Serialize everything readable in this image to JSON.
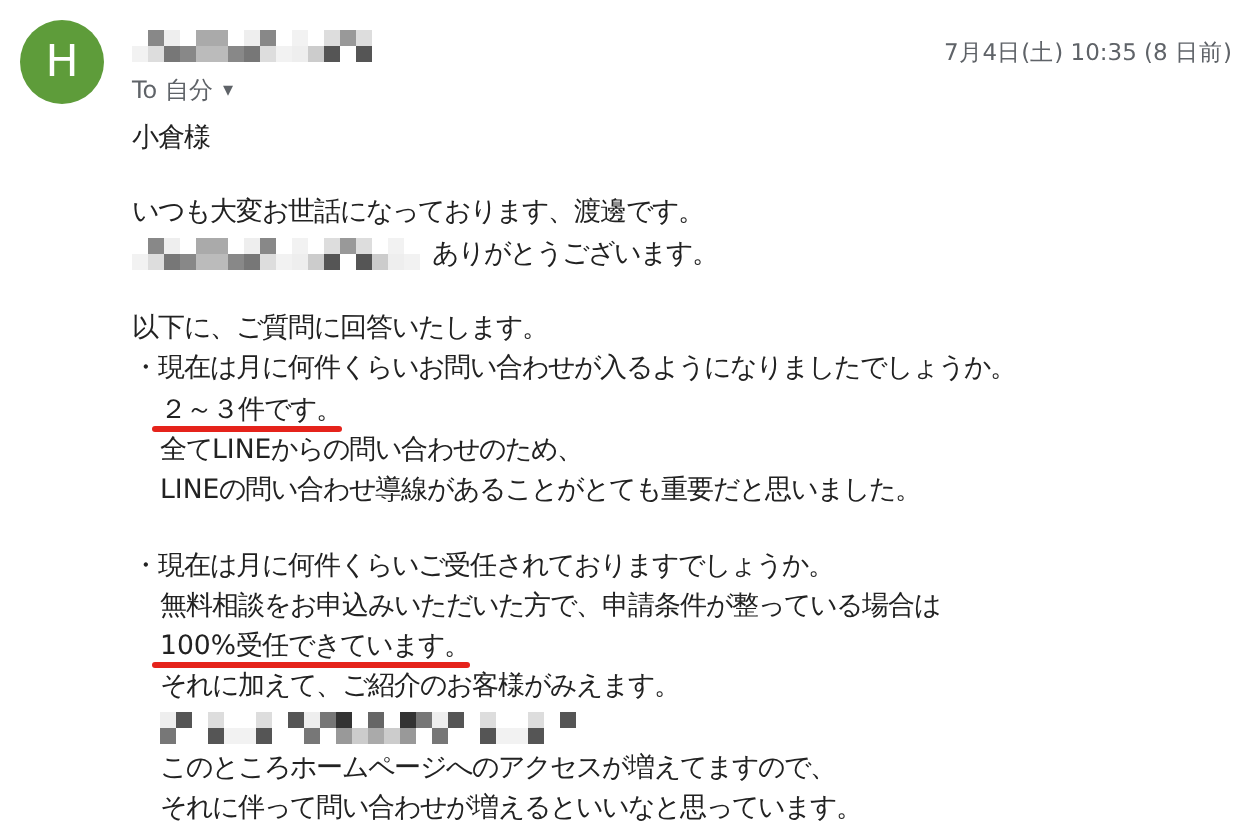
{
  "avatar": {
    "letter": "H",
    "color": "#5e9c3a"
  },
  "sender": {
    "kind": "redacted"
  },
  "recipient": {
    "label": "To 自分",
    "caret": "▾"
  },
  "date": "7月4日(土) 10:35 (8 日前)",
  "body": [
    {
      "kind": "text",
      "text": "小倉様"
    },
    {
      "kind": "blank"
    },
    {
      "kind": "text",
      "text": "いつも大変お世話になっております、渡邊です。"
    },
    {
      "kind": "redacted",
      "text": "ありがとうございます。"
    },
    {
      "kind": "blank"
    },
    {
      "kind": "text",
      "text": "以下に、ご質問に回答いたします。"
    },
    {
      "kind": "bullet",
      "bullet": "・",
      "text": "現在は月に何件くらいお問い合わせが入るようになりましたでしょうか。"
    },
    {
      "kind": "indent",
      "text": "２～３件です。",
      "underlined": true
    },
    {
      "kind": "indent",
      "text": "全てLINEからの問い合わせのため、"
    },
    {
      "kind": "indent",
      "text": "LINEの問い合わせ導線があることがとても重要だと思いました。"
    },
    {
      "kind": "blank"
    },
    {
      "kind": "bullet",
      "bullet": "・",
      "text": "現在は月に何件くらいご受任されておりますでしょうか。"
    },
    {
      "kind": "indent",
      "text": "無料相談をお申込みいただいた方で、申請条件が整っている場合は"
    },
    {
      "kind": "indent",
      "text": "100%受任できています。",
      "underlined": true
    },
    {
      "kind": "indent",
      "text": "それに加えて、ご紹介のお客様がみえます。"
    },
    {
      "kind": "indent_redacted"
    },
    {
      "kind": "indent",
      "text": "このところホームページへのアクセスが増えてますので、"
    },
    {
      "kind": "indent",
      "text": "それに伴って問い合わせが増えるといいなと思っています。"
    }
  ]
}
